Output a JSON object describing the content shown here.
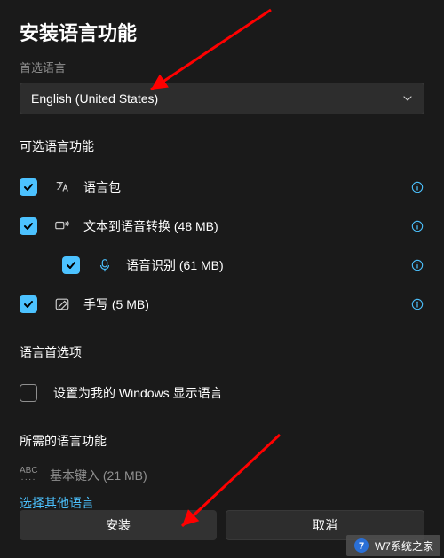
{
  "title": "安装语言功能",
  "preferred_label": "首选语言",
  "dropdown": {
    "value": "English (United States)"
  },
  "optional_heading": "可选语言功能",
  "features": [
    {
      "label": "语言包",
      "icon": "language-pack-icon",
      "checked": true,
      "indent": false,
      "info": true
    },
    {
      "label": "文本到语音转换 (48 MB)",
      "icon": "tts-icon",
      "checked": true,
      "indent": false,
      "info": true
    },
    {
      "label": "语音识别 (61 MB)",
      "icon": "speech-icon",
      "checked": true,
      "indent": true,
      "info": true
    },
    {
      "label": "手写 (5 MB)",
      "icon": "handwriting-icon",
      "checked": true,
      "indent": false,
      "info": true
    }
  ],
  "prefs_heading": "语言首选项",
  "prefs": {
    "display_language_label": "设置为我的 Windows 显示语言",
    "checked": false
  },
  "required_heading": "所需的语言功能",
  "required": {
    "label": "基本键入 (21 MB)"
  },
  "link": "选择其他语言",
  "buttons": {
    "install": "安装",
    "cancel": "取消"
  },
  "watermark": "W7系统之家"
}
